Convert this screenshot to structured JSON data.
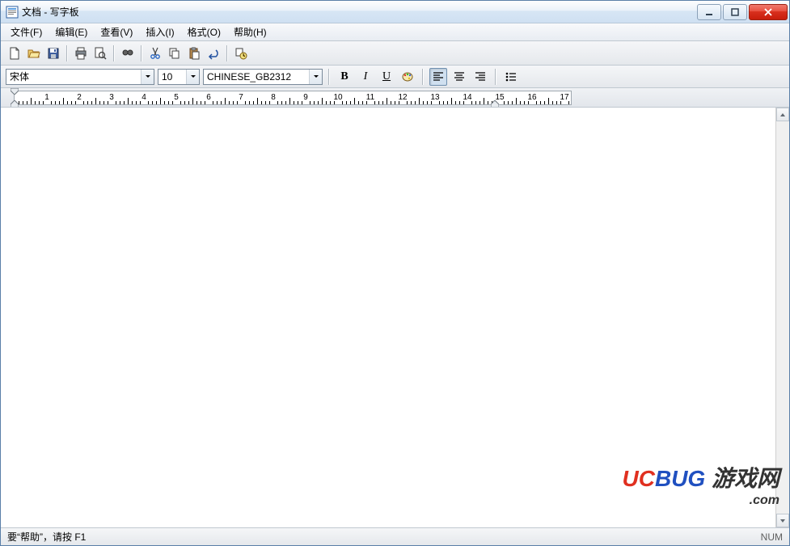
{
  "window": {
    "title": "文档 - 写字板"
  },
  "menu": {
    "items": [
      "文件(F)",
      "编辑(E)",
      "查看(V)",
      "插入(I)",
      "格式(O)",
      "帮助(H)"
    ]
  },
  "toolbar": {
    "new": "新建",
    "open": "打开",
    "save": "保存",
    "print": "打印",
    "preview": "打印预览",
    "find": "查找",
    "cut": "剪切",
    "copy": "复制",
    "paste": "粘贴",
    "undo": "撤销",
    "datetime": "日期/时间"
  },
  "format": {
    "font": "宋体",
    "size": "10",
    "script": "CHINESE_GB2312",
    "bold": "B",
    "italic": "I",
    "underline": "U",
    "color": "颜色",
    "align_left": "左对齐",
    "align_center": "居中",
    "align_right": "右对齐",
    "bullets": "项目符号"
  },
  "ruler": {
    "numbers": [
      "1",
      "2",
      "3",
      "4",
      "5",
      "6",
      "7",
      "8",
      "9",
      "10",
      "11",
      "12",
      "13",
      "14",
      "15",
      "16",
      "17"
    ]
  },
  "status": {
    "help": "要“帮助”，请按 F1",
    "num": "NUM"
  },
  "watermark": {
    "line1_a": "UC",
    "line1_b": "BUG",
    "line1_c": "游戏网",
    "line2": ".com"
  }
}
